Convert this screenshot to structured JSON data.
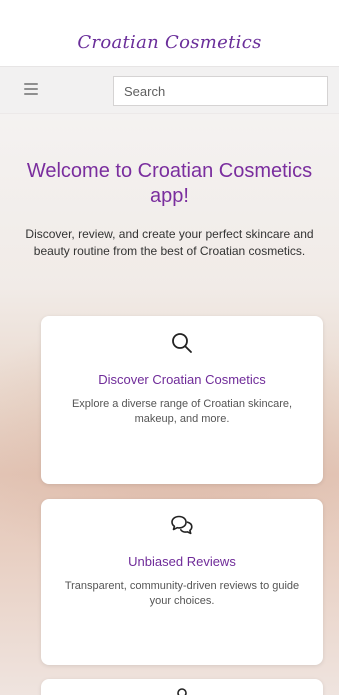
{
  "header": {
    "brand": "Croatian Cosmetics"
  },
  "topbar": {
    "menu_icon": "hamburger-menu-icon",
    "search_placeholder": "Search"
  },
  "hero": {
    "title": "Welcome to Croatian Cosmetics app!",
    "intro": "Discover, review, and create your perfect skincare and beauty routine from the best of Croatian cosmetics."
  },
  "features": [
    {
      "icon": "search-icon",
      "title": "Discover Croatian Cosmetics",
      "description": "Explore a diverse range of Croatian skincare, makeup, and more."
    },
    {
      "icon": "chat-bubbles-icon",
      "title": "Unbiased Reviews",
      "description": "Transparent, community-driven reviews to guide your choices."
    },
    {
      "icon": "partial-feature-icon"
    }
  ],
  "colors": {
    "brand_purple": "#6a2e9a",
    "title_purple": "#7a2e9e",
    "card_bg": "#ffffff",
    "topbar_bg": "#f2f1f1"
  }
}
